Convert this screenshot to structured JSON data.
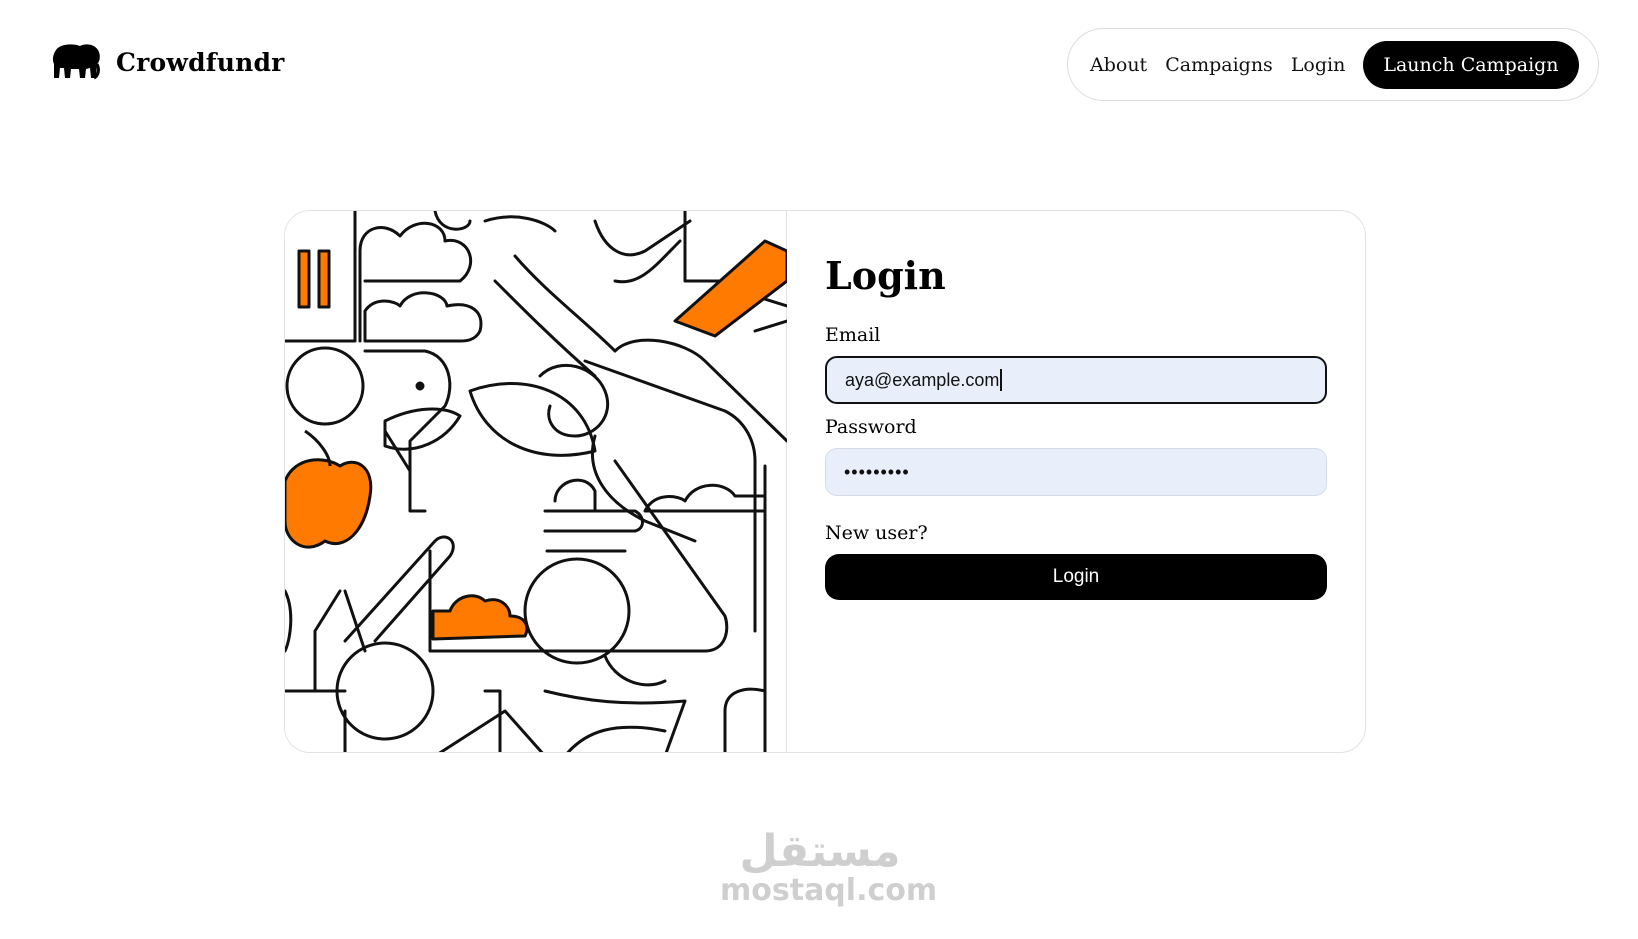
{
  "brand": {
    "name": "Crowdfundr",
    "logo_icon": "elephant-icon"
  },
  "nav": {
    "links": [
      "About",
      "Campaigns",
      "Login"
    ],
    "cta": "Launch Campaign"
  },
  "login": {
    "title": "Login",
    "email_label": "Email",
    "email_value": "aya@example.com",
    "password_label": "Password",
    "password_value": "•••••••••",
    "new_user_text": "New user?",
    "submit_label": "Login"
  },
  "colors": {
    "accent_orange": "#ff7a00",
    "field_bg": "#e8effb",
    "button_black": "#000000"
  },
  "watermark": {
    "arabic": "مستقل",
    "latin": "mostaql.com"
  }
}
